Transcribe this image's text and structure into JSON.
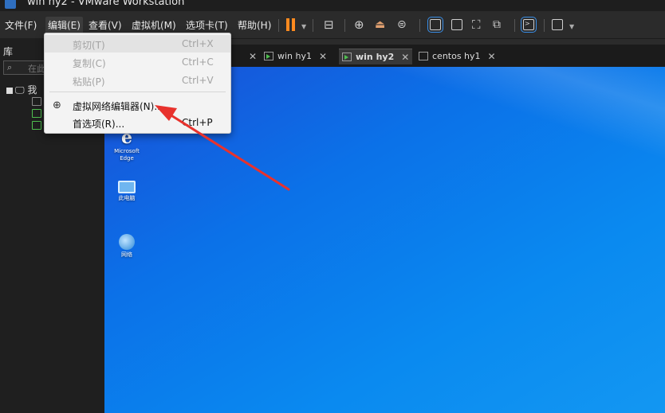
{
  "window": {
    "title": "win hy2 - VMware Workstation"
  },
  "menubar": {
    "items": [
      "文件(F)",
      "编辑(E)",
      "查看(V)",
      "虚拟机(M)",
      "选项卡(T)",
      "帮助(H)"
    ]
  },
  "sidebar": {
    "library_label": "库",
    "search_placeholder": "在此",
    "tree_root": "我"
  },
  "tabs": [
    {
      "label": "win hy1",
      "running": true,
      "active": false
    },
    {
      "label": "win hy2",
      "running": true,
      "active": true
    },
    {
      "label": "centos  hy1",
      "running": false,
      "active": false
    }
  ],
  "desktop_icons": [
    {
      "label": "Microsoft Edge",
      "icon": "edge-icon"
    },
    {
      "label": "此电脑",
      "icon": "this-pc-icon"
    },
    {
      "label": "网络",
      "icon": "network-icon"
    }
  ],
  "edit_menu": {
    "items": [
      {
        "label": "剪切(T)",
        "shortcut": "Ctrl+X",
        "enabled": false
      },
      {
        "label": "复制(C)",
        "shortcut": "Ctrl+C",
        "enabled": false
      },
      {
        "label": "粘贴(P)",
        "shortcut": "Ctrl+V",
        "enabled": false
      },
      {
        "label": "虚拟网络编辑器(N)...",
        "shortcut": "",
        "enabled": true,
        "icon": "globe-icon"
      },
      {
        "label": "首选项(R)...",
        "shortcut": "Ctrl+P",
        "enabled": true
      }
    ]
  },
  "colors": {
    "pause": "#ff8a1f",
    "arrow": "#e8322d",
    "desktop": "#0b71e8"
  }
}
